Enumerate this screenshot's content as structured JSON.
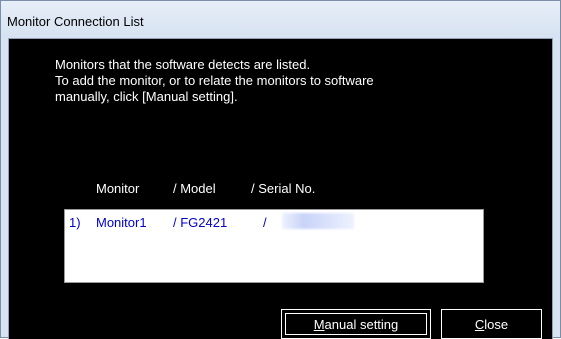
{
  "window": {
    "title": "Monitor Connection List"
  },
  "description": {
    "line1": "Monitors that the software detects are listed.",
    "line2": "To add the monitor, or to relate the monitors to software",
    "line3": "manually, click [Manual setting]."
  },
  "list": {
    "headers": {
      "monitor": "Monitor",
      "model": "/ Model",
      "serial": "/ Serial No."
    },
    "rows": [
      {
        "index": "1)",
        "monitor": "Monitor1",
        "model": "/ FG2421",
        "serial_sep": "/"
      }
    ]
  },
  "buttons": {
    "manual_setting": {
      "mnemonic": "M",
      "rest": "anual setting"
    },
    "close": {
      "mnemonic": "C",
      "rest": "lose"
    }
  },
  "colors": {
    "background": "#000000",
    "text": "#ffffff",
    "list_text": "#0000cc",
    "titlebar": "#dbe6f4"
  }
}
